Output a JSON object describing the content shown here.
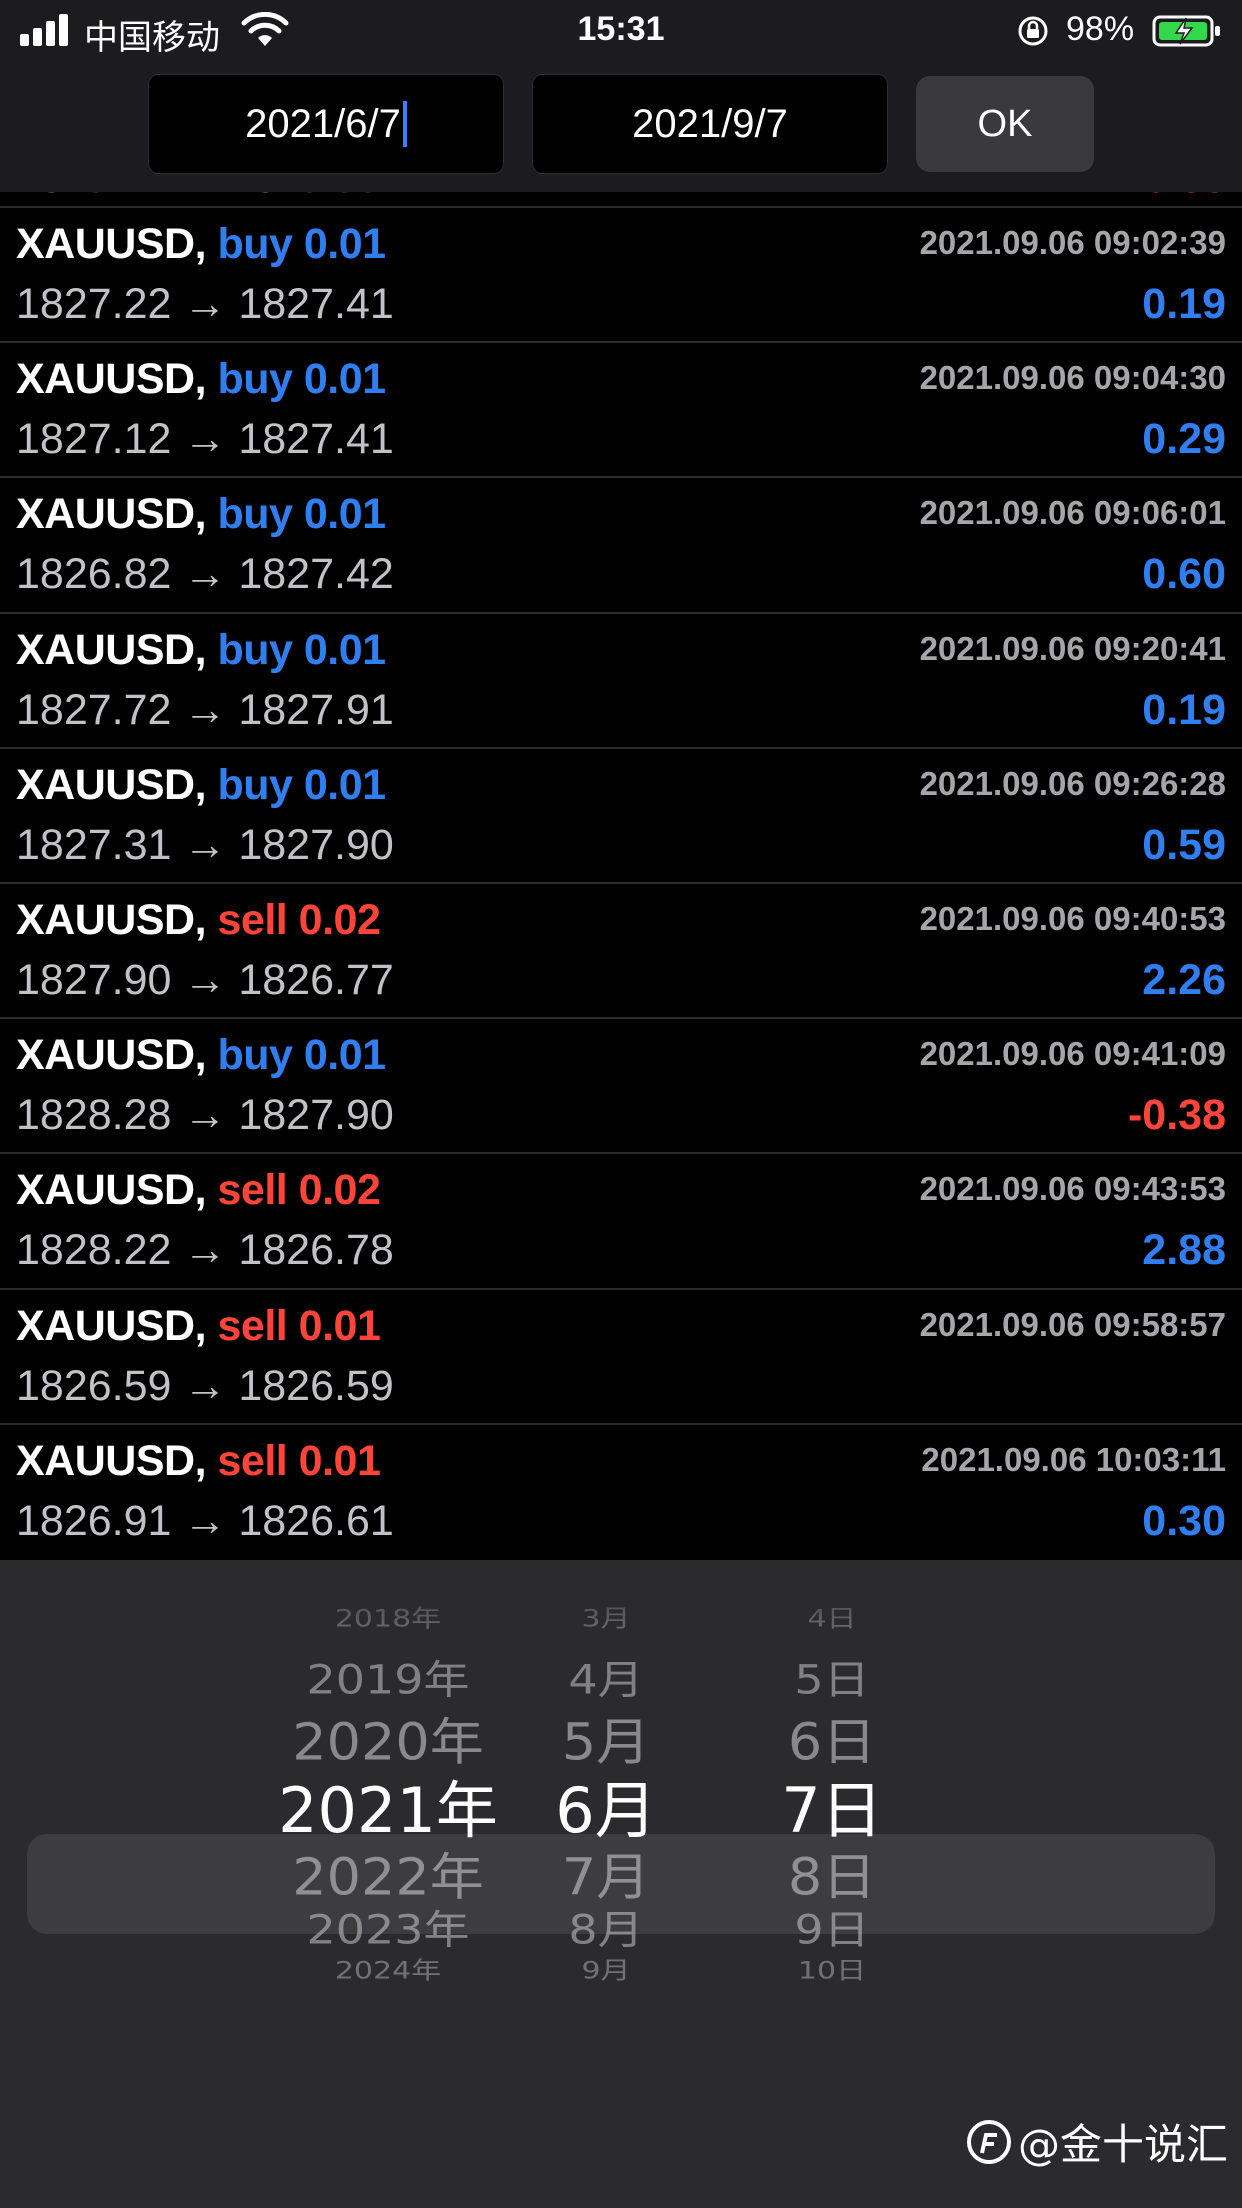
{
  "status_bar": {
    "carrier": "中国移动",
    "time": "15:31",
    "battery": "98%"
  },
  "date_range": {
    "from": "2021/6/7",
    "to": "2021/9/7",
    "ok_label": "OK"
  },
  "colors": {
    "buy": "#2f7ff3",
    "sell": "#ff453a",
    "profit_positive": "#2f7ff3",
    "profit_negative": "#ff453a"
  },
  "trades": [
    {
      "symbol": "XAUUSD,",
      "side": "buy",
      "volume": "0.01",
      "time": "2021.09.06 09:02:39",
      "open": "1827.22",
      "arrow": "→",
      "close": "1827.41",
      "profit": "0.19"
    },
    {
      "symbol": "XAUUSD,",
      "side": "buy",
      "volume": "0.01",
      "time": "2021.09.06 09:04:30",
      "open": "1827.12",
      "arrow": "→",
      "close": "1827.41",
      "profit": "0.29"
    },
    {
      "symbol": "XAUUSD,",
      "side": "buy",
      "volume": "0.01",
      "time": "2021.09.06 09:06:01",
      "open": "1826.82",
      "arrow": "→",
      "close": "1827.42",
      "profit": "0.60"
    },
    {
      "symbol": "XAUUSD,",
      "side": "buy",
      "volume": "0.01",
      "time": "2021.09.06 09:20:41",
      "open": "1827.72",
      "arrow": "→",
      "close": "1827.91",
      "profit": "0.19"
    },
    {
      "symbol": "XAUUSD,",
      "side": "buy",
      "volume": "0.01",
      "time": "2021.09.06 09:26:28",
      "open": "1827.31",
      "arrow": "→",
      "close": "1827.90",
      "profit": "0.59"
    },
    {
      "symbol": "XAUUSD,",
      "side": "sell",
      "volume": "0.02",
      "time": "2021.09.06 09:40:53",
      "open": "1827.90",
      "arrow": "→",
      "close": "1826.77",
      "profit": "2.26"
    },
    {
      "symbol": "XAUUSD,",
      "side": "buy",
      "volume": "0.01",
      "time": "2021.09.06 09:41:09",
      "open": "1828.28",
      "arrow": "→",
      "close": "1827.90",
      "profit": "-0.38"
    },
    {
      "symbol": "XAUUSD,",
      "side": "sell",
      "volume": "0.02",
      "time": "2021.09.06 09:43:53",
      "open": "1828.22",
      "arrow": "→",
      "close": "1826.78",
      "profit": "2.88"
    },
    {
      "symbol": "XAUUSD,",
      "side": "sell",
      "volume": "0.01",
      "time": "2021.09.06 09:58:57",
      "open": "1826.59",
      "arrow": "→",
      "close": "1826.59",
      "profit": ""
    },
    {
      "symbol": "XAUUSD,",
      "side": "sell",
      "volume": "0.01",
      "time": "2021.09.06 10:03:11",
      "open": "1826.91",
      "arrow": "→",
      "close": "1826.61",
      "profit": "0.30"
    }
  ],
  "picker": {
    "years": [
      "2018年",
      "2019年",
      "2020年",
      "2021年",
      "2022年",
      "2023年",
      "2024年"
    ],
    "months": [
      "3月",
      "4月",
      "5月",
      "6月",
      "7月",
      "8月",
      "9月"
    ],
    "days": [
      "4日",
      "5日",
      "6日",
      "7日",
      "8日",
      "9日",
      "10日"
    ],
    "selected_index": 3
  },
  "watermark": "@金十说汇"
}
